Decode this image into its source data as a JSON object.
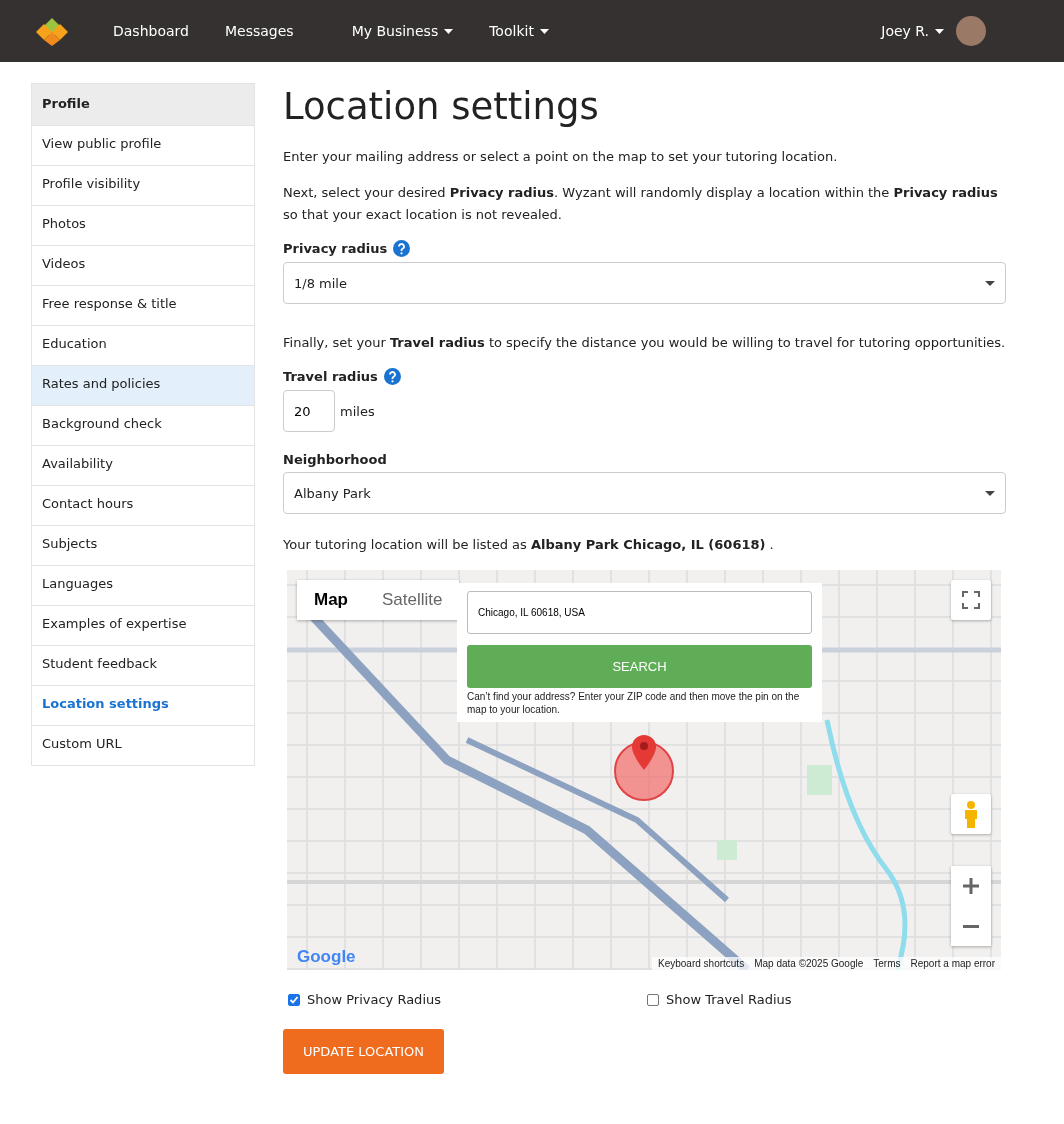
{
  "navbar": {
    "links": [
      {
        "label": "Dashboard",
        "dropdown": false
      },
      {
        "label": "Messages",
        "dropdown": false
      },
      {
        "label": "My Business",
        "dropdown": true
      },
      {
        "label": "Toolkit",
        "dropdown": true
      }
    ],
    "user": {
      "label": "Joey R.",
      "dropdown": true
    }
  },
  "sidebar": {
    "heading": "Profile",
    "items": [
      {
        "label": "View public profile",
        "selected": false,
        "hovered": false
      },
      {
        "label": "Profile visibility",
        "selected": false,
        "hovered": false
      },
      {
        "label": "Photos",
        "selected": false,
        "hovered": false
      },
      {
        "label": "Videos",
        "selected": false,
        "hovered": false
      },
      {
        "label": "Free response & title",
        "selected": false,
        "hovered": false
      },
      {
        "label": "Education",
        "selected": false,
        "hovered": false
      },
      {
        "label": "Rates and policies",
        "selected": false,
        "hovered": true
      },
      {
        "label": "Background check",
        "selected": false,
        "hovered": false
      },
      {
        "label": "Availability",
        "selected": false,
        "hovered": false
      },
      {
        "label": "Contact hours",
        "selected": false,
        "hovered": false
      },
      {
        "label": "Subjects",
        "selected": false,
        "hovered": false
      },
      {
        "label": "Languages",
        "selected": false,
        "hovered": false
      },
      {
        "label": "Examples of expertise",
        "selected": false,
        "hovered": false
      },
      {
        "label": "Student feedback",
        "selected": false,
        "hovered": false
      },
      {
        "label": "Location settings",
        "selected": true,
        "hovered": false
      },
      {
        "label": "Custom URL",
        "selected": false,
        "hovered": false
      }
    ]
  },
  "page": {
    "title": "Location settings",
    "intro": "Enter your mailing address or select a point on the map to set your tutoring location.",
    "privacy_text": "Next, select your desired **Privacy radius**. Wyzant will randomly display a location within the **Privacy radius** so that your exact location is not revealed.",
    "privacy_radius": {
      "label": "Privacy radius",
      "value": "1/8 mile"
    },
    "travel_text": "Finally, set your **Travel radius** to specify the distance you would be willing to travel for tutoring opportunities.",
    "travel_radius": {
      "label": "Travel radius",
      "value": "20",
      "unit": "miles"
    },
    "neighborhood": {
      "label": "Neighborhood",
      "value": "Albany Park"
    },
    "listing_text": "Your tutoring location will be listed as **Albany Park Chicago, IL (60618)** .",
    "map": {
      "tabs": [
        {
          "label": "Map",
          "selected": true
        },
        {
          "label": "Satellite",
          "selected": false
        }
      ],
      "search_value": "Chicago, IL 60618, USA",
      "search_button": "SEARCH",
      "help": "Can’t find your address? Enter your ZIP code and then move the pin on the map to your location.",
      "logo": "Google",
      "footer": [
        "Keyboard shortcuts",
        "Map data ©2025 Google",
        "Terms",
        "Report a map error"
      ]
    },
    "checkboxes": [
      {
        "label": "Show Privacy Radius",
        "checked": true
      },
      {
        "label": "Show Travel Radius",
        "checked": false
      }
    ],
    "submit": "UPDATE LOCATION"
  }
}
